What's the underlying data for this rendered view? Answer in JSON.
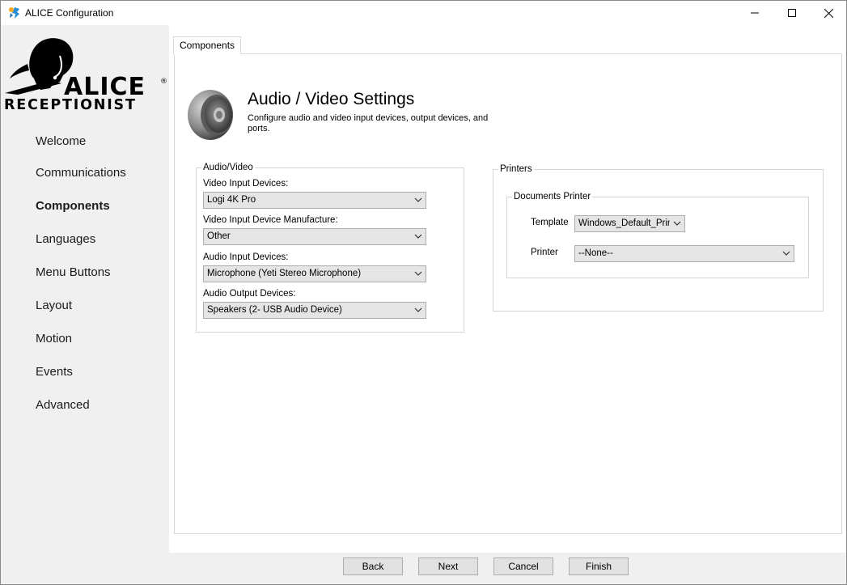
{
  "window": {
    "title": "ALICE Configuration",
    "controls": {
      "minimize": "minimize-icon",
      "maximize": "maximize-icon",
      "close": "close-icon"
    }
  },
  "logo": {
    "line1": "ALICE",
    "line2": "RECEPTIONIST",
    "mark": "®"
  },
  "sidebar": {
    "items": [
      {
        "label": "Welcome",
        "active": false
      },
      {
        "label": "Communications",
        "active": false
      },
      {
        "label": "Components",
        "active": true
      },
      {
        "label": "Languages",
        "active": false
      },
      {
        "label": "Menu Buttons",
        "active": false
      },
      {
        "label": "Layout",
        "active": false
      },
      {
        "label": "Motion",
        "active": false
      },
      {
        "label": "Events",
        "active": false
      },
      {
        "label": "Advanced",
        "active": false
      }
    ]
  },
  "main": {
    "tab": "Components",
    "heading": "Audio / Video Settings",
    "subheading": "Configure audio and video input devices, output devices, and ports.",
    "audio_video": {
      "legend": "Audio/Video",
      "fields": [
        {
          "label": "Video Input Devices:",
          "value": "Logi 4K Pro"
        },
        {
          "label": "Video Input Device Manufacture:",
          "value": "Other"
        },
        {
          "label": "Audio Input Devices:",
          "value": "Microphone (Yeti Stereo Microphone)"
        },
        {
          "label": "Audio Output Devices:",
          "value": "Speakers (2- USB Audio Device)"
        }
      ]
    },
    "printers": {
      "legend": "Printers",
      "documents_printer": {
        "legend": "Documents Printer",
        "template_label": "Template",
        "template_value": "Windows_Default_Printer",
        "printer_label": "Printer",
        "printer_value": "--None--"
      }
    }
  },
  "footer": {
    "back": "Back",
    "next": "Next",
    "cancel": "Cancel",
    "finish": "Finish"
  }
}
